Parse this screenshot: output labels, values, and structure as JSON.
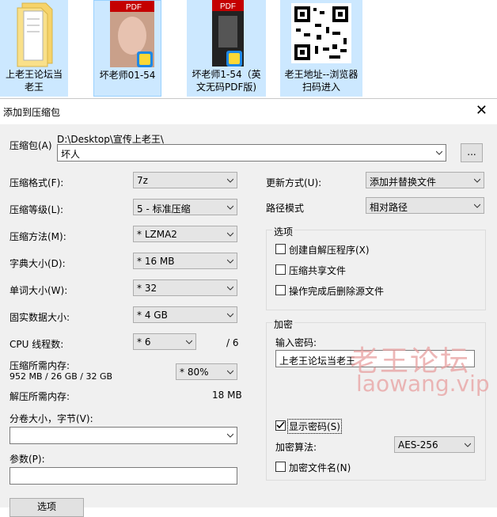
{
  "desktop": {
    "icons": [
      {
        "label": "上老王论坛当老王"
      },
      {
        "label": "坏老师01-54"
      },
      {
        "label": "坏老师1-54（英文无码PDF版)"
      },
      {
        "label": "老王地址--浏览器扫码进入"
      }
    ],
    "pdf_badge": "PDF"
  },
  "dialog": {
    "title": "添加到压缩包",
    "close_glyph": "✕",
    "archive_label": "压缩包(A)",
    "archive_path": "D:\\Desktop\\宣传上老王\\",
    "archive_name": "坏人",
    "browse_label": "...",
    "format_label": "压缩格式(F):",
    "format_value": "7z",
    "level_label": "压缩等级(L):",
    "level_value": "5 - 标准压缩",
    "method_label": "压缩方法(M):",
    "method_value": "*  LZMA2",
    "dict_label": "字典大小(D):",
    "dict_value": "*  16 MB",
    "word_label": "单词大小(W):",
    "word_value": "*  32",
    "solid_label": "固实数据大小:",
    "solid_value": "*  4 GB",
    "cpu_label": "CPU 线程数:",
    "cpu_value": "*  6",
    "cpu_total": "/ 6",
    "mem_label": "压缩所需内存:",
    "mem_detail": "952 MB / 26 GB / 32 GB",
    "mem_value": "*  80%",
    "decomp_label": "解压所需内存:",
    "decomp_value": "18 MB",
    "split_label": "分卷大小，字节(V):",
    "split_value": "",
    "params_label": "参数(P):",
    "params_value": "",
    "options_button": "选项",
    "update_label": "更新方式(U):",
    "update_value": "添加并替换文件",
    "path_mode_label": "路径模式",
    "path_mode_value": "相对路径",
    "options_group": "选项",
    "opt_sfx": "创建自解压程序(X)",
    "opt_shared": "压缩共享文件",
    "opt_delete": "操作完成后删除源文件",
    "encrypt_group": "加密",
    "password_label": "输入密码:",
    "password_value": "上老王论坛当老王",
    "show_password": "显示密码(S)",
    "enc_method_label": "加密算法:",
    "enc_method_value": "AES-256",
    "encrypt_names": "加密文件名(N)"
  },
  "watermark": {
    "line1": "老王论坛",
    "line2": "laowang.vip"
  },
  "colors": {
    "selection": "#cce8ff",
    "dialog_bg": "#f0f0f0",
    "watermark": "#e8a0a0"
  }
}
